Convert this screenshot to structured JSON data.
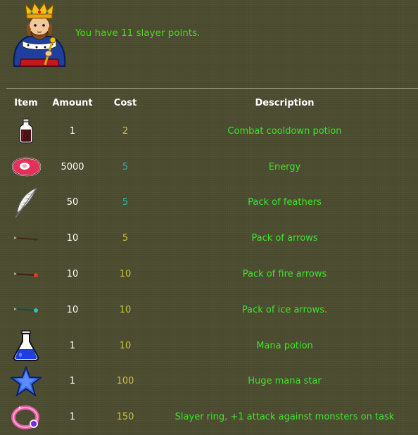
{
  "header": {
    "message": "You have 11 slayer points."
  },
  "table": {
    "headers": {
      "item": "Item",
      "amount": "Amount",
      "cost": "Cost",
      "description": "Description"
    },
    "rows": [
      {
        "icon": "potion-bottle-icon",
        "amount": "1",
        "cost": "2",
        "description": "Combat cooldown potion"
      },
      {
        "icon": "meat-steak-icon",
        "amount": "5000",
        "cost": "5",
        "description": "Energy"
      },
      {
        "icon": "feather-icon",
        "amount": "50",
        "cost": "5",
        "description": "Pack of feathers"
      },
      {
        "icon": "arrow-icon",
        "amount": "10",
        "cost": "5",
        "description": "Pack of arrows"
      },
      {
        "icon": "fire-arrow-icon",
        "amount": "10",
        "cost": "10",
        "description": "Pack of fire arrows"
      },
      {
        "icon": "ice-arrow-icon",
        "amount": "10",
        "cost": "10",
        "description": "Pack of ice arrows."
      },
      {
        "icon": "mana-potion-flask-icon",
        "amount": "1",
        "cost": "10",
        "description": "Mana potion"
      },
      {
        "icon": "blue-star-icon",
        "amount": "1",
        "cost": "100",
        "description": "Huge mana star"
      },
      {
        "icon": "pink-ring-icon",
        "amount": "1",
        "cost": "150",
        "description": "Slayer ring, +1 attack against monsters on task"
      }
    ]
  },
  "colors": {
    "background": "#4b4b30",
    "message_green": "#4dd81c",
    "description_green": "#3de52a",
    "cost_yellow": "#c9c23a",
    "cost_teal": "#2bb5a6",
    "header_white": "#ffffff"
  }
}
